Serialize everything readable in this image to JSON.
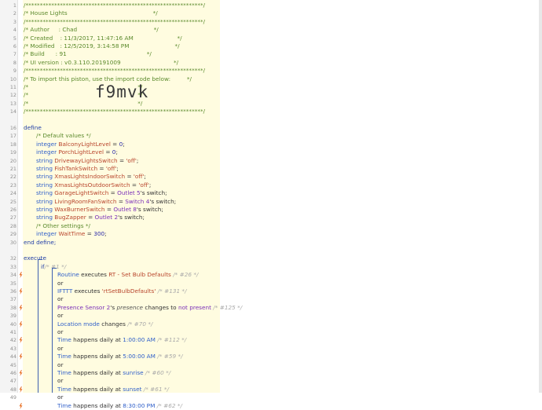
{
  "header_comments": [
    "/**************************************************************/",
    "/* House Lights                                               */",
    "/**************************************************************/",
    "/* Author     : Chad                                          */",
    "/* Created    : 11/3/2017, 11:47:16 AM                        */",
    "/* Modified   : 12/5/2019, 3:14:58 PM                         */",
    "/* Build      : 91                                            */",
    "/* UI version : v0.3.110.20191009                             */",
    "/**************************************************************/",
    "/* To import this piston, use the import code below:         */",
    "/*                                                            */",
    "/*                                                            */",
    "/*                                                            */",
    "/**************************************************************/"
  ],
  "import_code": "f9mvk",
  "line_numbers": [
    "1",
    "2",
    "3",
    "4",
    "5",
    "6",
    "7",
    "8",
    "9",
    "10",
    "11",
    "12",
    "13",
    "14",
    "15",
    "16",
    "17",
    "18",
    "19",
    "20",
    "21",
    "22",
    "23",
    "24",
    "25",
    "26",
    "27",
    "28",
    "29",
    "30",
    "31",
    "32",
    "33",
    "34",
    "35",
    "36",
    "37",
    "38",
    "39",
    "40",
    "41",
    "42",
    "43",
    "44",
    "45",
    "46",
    "47",
    "48",
    "49"
  ],
  "define": {
    "keyword": "define",
    "default_comment": "/* Default values */",
    "variables": [
      {
        "type": "integer",
        "name": "BalconyLightLevel",
        "eq": " = ",
        "value": "0",
        "end": ";"
      },
      {
        "type": "integer",
        "name": "PorchLightLevel",
        "eq": " = ",
        "value": "0",
        "end": ";"
      },
      {
        "type": "string",
        "name": "DrivewayLightsSwitch",
        "eq": " = ",
        "value": "'off'",
        "end": ";"
      },
      {
        "type": "string",
        "name": "FishTankSwitch",
        "eq": " = ",
        "value": "'off'",
        "end": ";"
      },
      {
        "type": "string",
        "name": "XmasLightsIndoorSwitch",
        "eq": " = ",
        "value": "'off'",
        "end": ";"
      },
      {
        "type": "string",
        "name": "XmasLightsOutdoorSwitch",
        "eq": " = ",
        "value": "'off'",
        "end": ";"
      },
      {
        "type": "string",
        "name": "GarageLightSwitch",
        "eq": " = ",
        "value": "Outlet 5",
        "end": "'s switch;"
      },
      {
        "type": "string",
        "name": "LivingRoomFanSwitch",
        "eq": " = ",
        "value": "Switch 4",
        "end": "'s switch;"
      },
      {
        "type": "string",
        "name": "WaxBurnerSwitch",
        "eq": " = ",
        "value": "Outlet 8",
        "end": "'s switch;"
      },
      {
        "type": "string",
        "name": "BugZapper",
        "eq": " = ",
        "value": "Outlet 2",
        "end": "'s switch;"
      }
    ],
    "other_comment": "/* Other settings */",
    "wait": {
      "type": "integer",
      "name": "WaitTime",
      "eq": " = ",
      "value": "300",
      "end": ";"
    },
    "end": "end define;"
  },
  "execute": {
    "keyword": "execute",
    "if_keyword": "if",
    "if_comment": "/* #1 */",
    "or": "or",
    "routine": {
      "subject": "Routine",
      "verb": " executes ",
      "object": "RT - Set Bulb Defaults",
      "comment": " /* #26 */"
    },
    "ifttt": {
      "subject": "IFTTT",
      "verb": " executes ",
      "object": "'rtSetBulbDefaults'",
      "comment": " /* #131 */"
    },
    "presence": {
      "subject": "Presence Sensor 2",
      "poss": "'s ",
      "attr": "presence",
      "verb": " changes to ",
      "object": "not present",
      "comment": " /* #125 */"
    },
    "location": {
      "subject": "Location mode",
      "verb": " changes",
      "comment": " /* #70 */"
    },
    "times": [
      {
        "subject": "Time",
        "verb": " happens daily at ",
        "object": "1:00:00 AM",
        "comment": " /* #112 */"
      },
      {
        "subject": "Time",
        "verb": " happens daily at ",
        "object": "5:00:00 AM",
        "comment": " /* #59 */"
      },
      {
        "subject": "Time",
        "verb": " happens daily at ",
        "object": "sunrise",
        "comment": " /* #60 */"
      },
      {
        "subject": "Time",
        "verb": " happens daily at ",
        "object": "sunset",
        "comment": " /* #61 */"
      },
      {
        "subject": "Time",
        "verb": " happens daily at ",
        "object": "8:30:00 PM",
        "comment": " /* #62 */"
      }
    ]
  },
  "colors": {
    "code_bg": "#fffce0",
    "bolt": "#e8742a",
    "keyword": "#2441a8",
    "comment": "#5b8a2c"
  },
  "icons": {
    "trigger": "lightning-bolt-icon"
  }
}
